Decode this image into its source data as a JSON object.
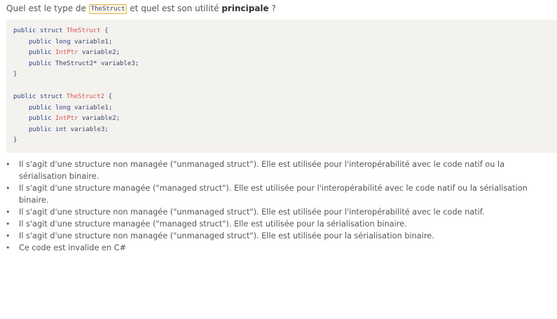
{
  "question": {
    "part1": "Quel est le type de ",
    "code": "TheStruct",
    "part2": " et quel est son utilité ",
    "bold": "principale",
    "part3": " ?"
  },
  "code_block": {
    "s1": {
      "l1": [
        "public",
        "struct",
        "TheStruct",
        "{"
      ],
      "l2": [
        "public",
        "long",
        "variable1;"
      ],
      "l3": [
        "public",
        "IntPtr",
        "variable2;"
      ],
      "l4": [
        "public",
        "TheStruct2*",
        "variable3;"
      ],
      "l5": "}"
    },
    "s2": {
      "l1": [
        "public",
        "struct",
        "TheStruct2",
        "{"
      ],
      "l2": [
        "public",
        "long",
        "variable1;"
      ],
      "l3": [
        "public",
        "IntPtr",
        "variable2;"
      ],
      "l4": [
        "public",
        "int",
        "variable3;"
      ],
      "l5": "}"
    }
  },
  "answers": [
    "Il s'agit d'une structure non managée (\"unmanaged struct\"). Elle est utilisée pour l'interopérabilité avec le code natif ou la sérialisation binaire.",
    "Il s'agit d'une structure managée (\"managed struct\"). Elle est utilisée pour l'interopérabilité avec le code natif ou la sérialisation binaire.",
    "Il s'agit d'une structure non managée (\"unmanaged struct\"). Elle est utilisée pour l'interopérabilité avec le code natif.",
    "Il s'agit d'une structure managée (\"managed struct\"). Elle est utilisée pour la sérialisation binaire.",
    "Il s'agit d'une structure non managée (\"unmanaged struct\"). Elle est utilisée pour la sérialisation binaire.",
    "Ce code est invalide en C#"
  ],
  "bullet_glyph": "•"
}
